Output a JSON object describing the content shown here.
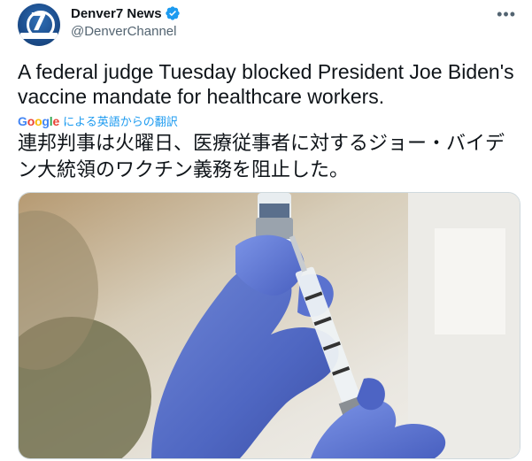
{
  "account": {
    "name": "Denver7 News",
    "handle": "@DenverChannel",
    "avatar_icon": "denver7-logo",
    "verified_icon": "verified-badge-icon"
  },
  "tweet": {
    "text_en": "A federal judge Tuesday blocked President Joe Biden's vaccine mandate for healthcare workers.",
    "translate_label": "による英語からの翻訳",
    "translated_text": "連邦判事は火曜日、医療従事者に対するジョー・バイデン大統領のワクチン義務を阻止した。"
  },
  "menu": {
    "more_label": "•••"
  },
  "google": {
    "brand": "Google"
  },
  "media": {
    "type": "photo",
    "description_icon": "vaccine-photo"
  }
}
